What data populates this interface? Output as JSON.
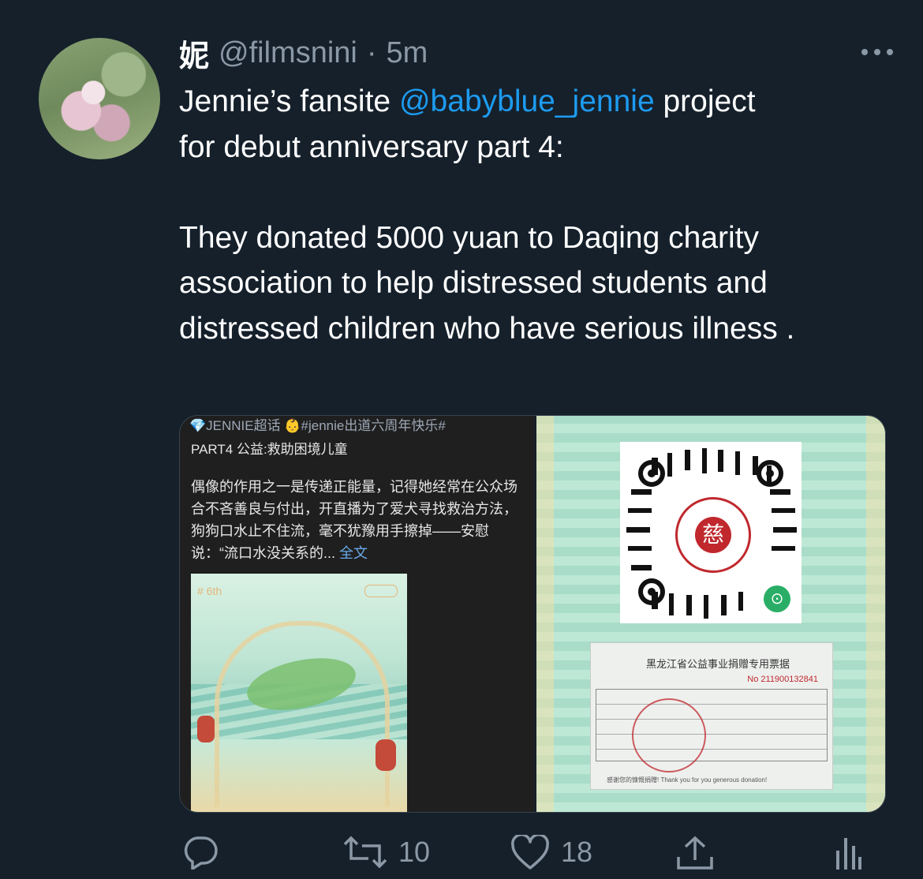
{
  "tweet": {
    "author_name": "妮",
    "handle": "@filmsnini",
    "separator": "·",
    "time": "5m",
    "text_before_mention": "Jennie’s fansite ",
    "mention": "@babyblue_jennie",
    "text_after_mention": " project\nfor debut anniversary part 4:\n\nThey donated 5000 yuan to Daqing charity association to help distressed students and distressed children who have serious illness ."
  },
  "media": {
    "left_panel": {
      "line1": "💎JENNIE超话 👶#jennie出道六周年快乐#",
      "line2": "PART4 公益:救助困境儿童",
      "body": "偶像的作用之一是传递正能量，记得她经常在公众场合不吝善良与付出，开直播为了爱犬寻找救治方法，狗狗口水止不住流，毫不犹豫用手擦掉——安慰说：“流口水没关系的...",
      "more_link": "全文",
      "poster_tag": "# 6th"
    },
    "right_panel": {
      "seal_char": "慈",
      "receipt_title": "黑龙江省公益事业捐赠专用票据",
      "receipt_no": "No 211900132841",
      "receipt_foot": "感谢您的慷慨捐赠! Thank you for you generous donation!"
    }
  },
  "actions": {
    "reply_count": "",
    "retweet_count": "10",
    "like_count": "18"
  },
  "colors": {
    "background": "#15202b",
    "secondary_text": "#8b98a5",
    "link": "#1d9bf0"
  },
  "icons": [
    "reply-icon",
    "retweet-icon",
    "like-icon",
    "share-icon",
    "analytics-icon",
    "more-icon"
  ]
}
